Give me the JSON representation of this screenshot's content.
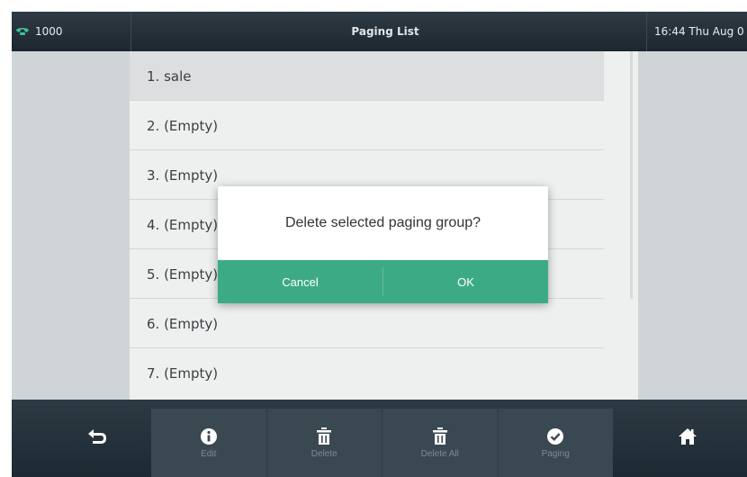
{
  "status_bar": {
    "line_label": "1000",
    "title": "Paging List",
    "clock": "16:44 Thu Aug 0"
  },
  "paging_list": {
    "items": [
      {
        "label": "1. sale",
        "selected": true
      },
      {
        "label": "2. (Empty)"
      },
      {
        "label": "3. (Empty)"
      },
      {
        "label": "4. (Empty)"
      },
      {
        "label": "5. (Empty)"
      },
      {
        "label": "6. (Empty)"
      },
      {
        "label": "7. (Empty)"
      }
    ]
  },
  "dialog": {
    "message": "Delete selected paging group?",
    "cancel_label": "Cancel",
    "ok_label": "OK"
  },
  "softkeys": {
    "edit": "Edit",
    "delete": "Delete",
    "delete_all": "Delete All",
    "paging": "Paging"
  },
  "colors": {
    "accent_green": "#3daa86",
    "bar_dark": "#1c262e"
  }
}
